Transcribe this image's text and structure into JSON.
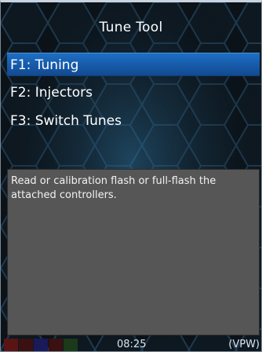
{
  "header": {
    "title": "Tune Tool"
  },
  "menu": {
    "items": [
      {
        "label": "F1: Tuning",
        "selected": true
      },
      {
        "label": "F2: Injectors",
        "selected": false
      },
      {
        "label": "F3: Switch Tunes",
        "selected": false
      }
    ]
  },
  "description": {
    "text": "Read or calibration flash or full-flash the attached controllers."
  },
  "status": {
    "indicator_colors": [
      "#5a1414",
      "#3a1010",
      "#1a1a5a",
      "#3a1010",
      "#1a3a1a"
    ],
    "time": "08:25",
    "protocol": "(VPW)"
  },
  "colors": {
    "selection": "#1658a6",
    "panel": "#565656",
    "hex_stroke": "#24465e"
  }
}
